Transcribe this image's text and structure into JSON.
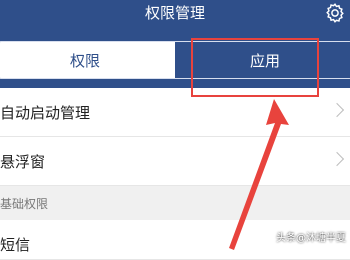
{
  "header": {
    "title": "权限管理",
    "settings_icon": "gear-icon"
  },
  "tabs": [
    {
      "label": "权限",
      "active": true
    },
    {
      "label": "应用",
      "active": false
    }
  ],
  "list": {
    "rows": [
      {
        "label": "自动启动管理"
      },
      {
        "label": "悬浮窗"
      }
    ],
    "section": "基础权限",
    "partial_row": "短信"
  },
  "annotations": {
    "highlight_color": "#e8433d",
    "arrow_color": "#e8433d"
  },
  "watermark": "头条@沐塘半夏",
  "colors": {
    "brand": "#2f4f8a",
    "list_bg": "#ffffff",
    "section_bg": "#f0f0f0"
  }
}
